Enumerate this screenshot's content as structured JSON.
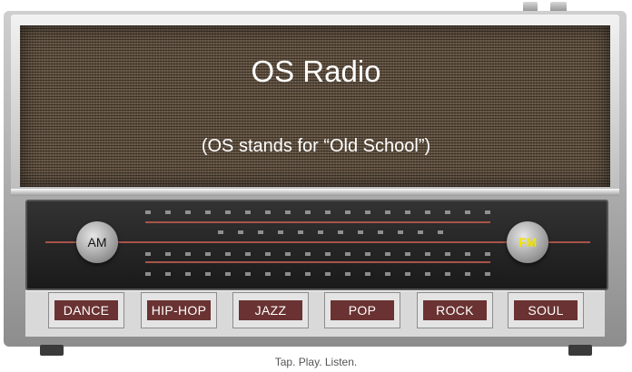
{
  "title": "OS Radio",
  "subtitle": "(OS stands for “Old School”)",
  "tagline": "Tap. Play. Listen.",
  "band_buttons": {
    "am": "AM",
    "fm": "FM"
  },
  "genres": [
    "DANCE",
    "HIP-HOP",
    "JAZZ",
    "POP",
    "ROCK",
    "SOUL"
  ],
  "colors": {
    "genre_button": "#6a3232",
    "fm_label": "#f1e300",
    "title_text": "#ffffff"
  }
}
